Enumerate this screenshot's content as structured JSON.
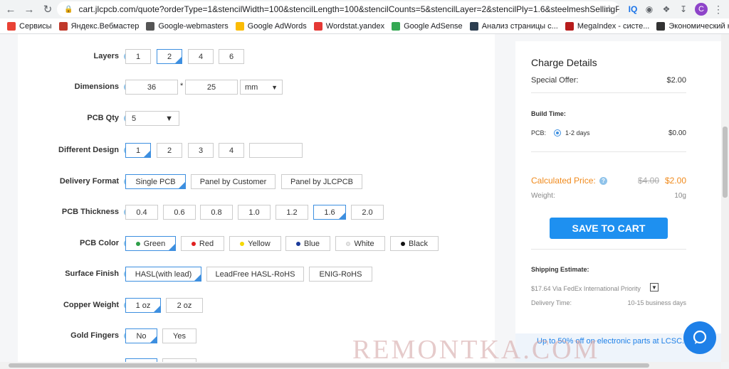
{
  "browser": {
    "url": "cart.jlcpcb.com/quote?orderType=1&stencilWidth=100&stencilLength=100&stencilCounts=5&stencilLayer=2&stencilPly=1.6&steelmeshSellingPriceRecord...",
    "profile_initial": "C",
    "ext_iq": "IQ"
  },
  "bookmarks": [
    {
      "label": "Сервисы",
      "color": "#e94235"
    },
    {
      "label": "Яндекс.Вебмастер",
      "color": "#c0392b"
    },
    {
      "label": "Google-webmasters",
      "color": "#555555"
    },
    {
      "label": "Google AdWords",
      "color": "#fbbc04"
    },
    {
      "label": "Wordstat.yandex",
      "color": "#e53935"
    },
    {
      "label": "Google AdSense",
      "color": "#34a853"
    },
    {
      "label": "Анализ страницы с...",
      "color": "#2c3e50"
    },
    {
      "label": "MegaIndex - систе...",
      "color": "#b71c1c"
    },
    {
      "label": "Экономический ка...",
      "color": "#333333"
    }
  ],
  "form": {
    "layers": {
      "label": "Layers",
      "options": [
        "1",
        "2",
        "4",
        "6"
      ]
    },
    "dimensions": {
      "label": "Dimensions",
      "width": "36",
      "sep": "*",
      "length": "25",
      "unit": "mm"
    },
    "pcb_qty": {
      "label": "PCB Qty",
      "value": "5"
    },
    "different_design": {
      "label": "Different Design",
      "options": [
        "1",
        "2",
        "3",
        "4"
      ]
    },
    "delivery_format": {
      "label": "Delivery Format",
      "options": [
        "Single PCB",
        "Panel by Customer",
        "Panel by JLCPCB"
      ]
    },
    "pcb_thickness": {
      "label": "PCB Thickness",
      "options": [
        "0.4",
        "0.6",
        "0.8",
        "1.0",
        "1.2",
        "1.6",
        "2.0"
      ]
    },
    "pcb_color": {
      "label": "PCB Color",
      "options": [
        {
          "label": "Green",
          "color": "#2e9e48"
        },
        {
          "label": "Red",
          "color": "#e02020"
        },
        {
          "label": "Yellow",
          "color": "#f5d800"
        },
        {
          "label": "Blue",
          "color": "#1a3a9a"
        },
        {
          "label": "White",
          "color": "#e8e8e8"
        },
        {
          "label": "Black",
          "color": "#111111"
        }
      ]
    },
    "surface_finish": {
      "label": "Surface Finish",
      "options": [
        "HASL(with lead)",
        "LeadFree HASL-RoHS",
        "ENIG-RoHS"
      ]
    },
    "copper_weight": {
      "label": "Copper Weight",
      "options": [
        "1 oz",
        "2 oz"
      ]
    },
    "gold_fingers": {
      "label": "Gold Fingers",
      "options": [
        "No",
        "Yes"
      ]
    }
  },
  "charge": {
    "title": "Charge Details",
    "special_offer_label": "Special Offer:",
    "special_offer_value": "$2.00",
    "build_time_label": "Build Time:",
    "pcb_label": "PCB:",
    "pcb_option": "1-2 days",
    "pcb_price": "$0.00",
    "calculated_label": "Calculated Price:",
    "old_price": "$4.00",
    "new_price": "$2.00",
    "weight_label": "Weight:",
    "weight_value": "10g",
    "save_button": "SAVE TO CART",
    "shipping_label": "Shipping Estimate:",
    "shipping_value": "$17.64  Via  FedEx International Priority",
    "delivery_label": "Delivery Time:",
    "delivery_value": "10-15 business days",
    "promo": "Up to 50% off on electronic parts at LCSC.Com"
  },
  "watermark": "REMONTKA.COM",
  "colors": {
    "accent": "#3d8fe0",
    "price_orange": "#f08a1c",
    "button_blue": "#1e90f0"
  }
}
